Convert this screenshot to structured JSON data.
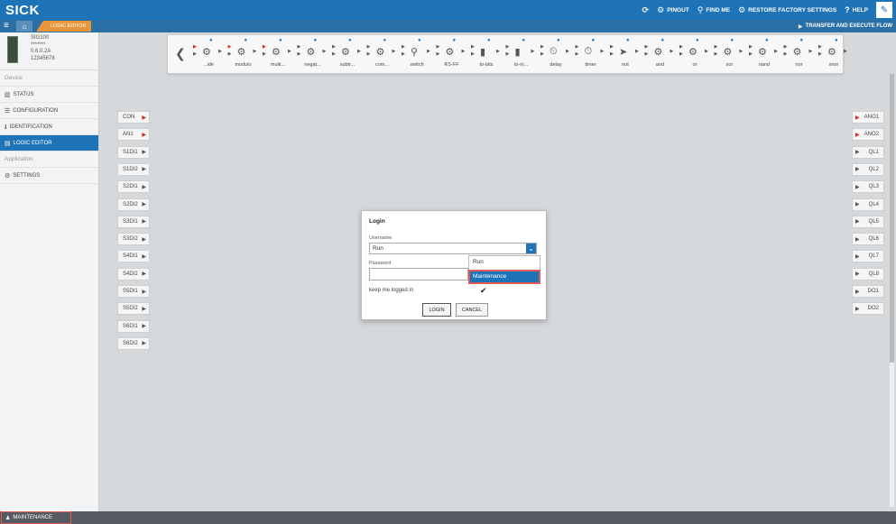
{
  "header": {
    "logo": "SICK",
    "actions": [
      {
        "icon": "refresh-icon",
        "glyph": "⟳",
        "label": ""
      },
      {
        "icon": "cogs-icon",
        "glyph": "⚙",
        "label": "PINOUT"
      },
      {
        "icon": "search-icon",
        "glyph": "⚲",
        "label": "FIND ME"
      },
      {
        "icon": "cogs-icon",
        "glyph": "⚙",
        "label": "RESTORE FACTORY SETTINGS"
      },
      {
        "icon": "question-icon",
        "glyph": "?",
        "label": "HELP"
      }
    ],
    "wrench_glyph": "✎"
  },
  "subbar": {
    "tab_label": "LOGIC EDITOR",
    "transfer_label": "TRANSFER AND EXECUTE FLOW",
    "play_glyph": "▶"
  },
  "sidebar": {
    "device": {
      "name": "SIG100",
      "serial": "*******",
      "version": "0.6.0.2A",
      "id": "12345678"
    },
    "section_device": "Device",
    "items": [
      {
        "label": "STATUS",
        "glyph": "▥",
        "icon": "chart-icon",
        "active": false
      },
      {
        "label": "CONFIGURATION",
        "glyph": "☰",
        "icon": "list-icon",
        "active": false
      },
      {
        "label": "IDENTIFICATION",
        "glyph": "ℹ",
        "icon": "info-icon",
        "active": false
      },
      {
        "label": "LOGIC EDITOR",
        "glyph": "▤",
        "icon": "document-icon",
        "active": true
      }
    ],
    "section_application": "Application",
    "settings": {
      "label": "SETTINGS",
      "glyph": "⚙",
      "icon": "cogs-icon"
    }
  },
  "toolbox": {
    "tools": [
      "...ide",
      "modulo",
      "multi...",
      "negat...",
      "subtr...",
      "com...",
      "switch",
      "RS-FF",
      "to-bits",
      "to-ni...",
      "delay",
      "timer",
      "not",
      "and",
      "or",
      "xor",
      "nand",
      "nor",
      "xnor"
    ]
  },
  "inputs": [
    {
      "label": "CON",
      "red": true
    },
    {
      "label": "AN1",
      "red": true
    },
    {
      "label": "S1DI1",
      "red": false
    },
    {
      "label": "S1DI2",
      "red": false
    },
    {
      "label": "S2DI1",
      "red": false
    },
    {
      "label": "S2DI2",
      "red": false
    },
    {
      "label": "S3DI1",
      "red": false
    },
    {
      "label": "S3DI2",
      "red": false
    },
    {
      "label": "S4DI1",
      "red": false
    },
    {
      "label": "S4DI2",
      "red": false
    },
    {
      "label": "S5DI1",
      "red": false
    },
    {
      "label": "S5DI2",
      "red": false
    },
    {
      "label": "S6DI1",
      "red": false
    },
    {
      "label": "S6DI2",
      "red": false
    }
  ],
  "outputs": [
    {
      "label": "ANO1",
      "red": true
    },
    {
      "label": "ANO2",
      "red": true
    },
    {
      "label": "QL1",
      "red": false
    },
    {
      "label": "QL2",
      "red": false
    },
    {
      "label": "QL3",
      "red": false
    },
    {
      "label": "QL4",
      "red": false
    },
    {
      "label": "QL5",
      "red": false
    },
    {
      "label": "QL6",
      "red": false
    },
    {
      "label": "QL7",
      "red": false
    },
    {
      "label": "QL8",
      "red": false
    },
    {
      "label": "DO1",
      "red": false
    },
    {
      "label": "DO2",
      "red": false
    }
  ],
  "login": {
    "title": "Login",
    "username_label": "Username",
    "username_value": "Run",
    "password_label": "Password",
    "options": [
      "Run",
      "Maintenance"
    ],
    "highlighted_option": "Maintenance",
    "keep_label": "keep me logged in",
    "keep_checked": true,
    "check_glyph": "✔",
    "login_button": "LOGIN",
    "cancel_button": "CANCEL"
  },
  "footer": {
    "user": "MAINTENANCE",
    "user_glyph": "♟"
  },
  "colors": {
    "primary": "#1f74b8",
    "accent": "#e8963a",
    "pin_red": "#d42323",
    "highlight": "#e05a5a"
  }
}
